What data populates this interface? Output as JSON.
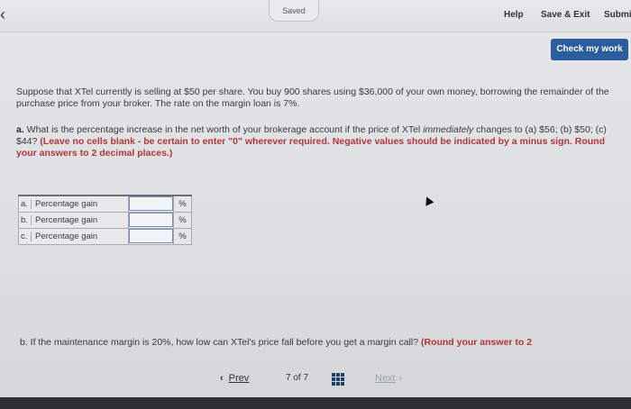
{
  "topbar": {
    "saved_label": "Saved",
    "help_label": "Help",
    "save_exit_label": "Save & Exit",
    "submit_label": "Submi"
  },
  "check_work_label": "Check my work",
  "question": {
    "text": "Suppose that XTel currently is selling at $50 per share. You buy 900 shares using $36,000 of your own money, borrowing the remainder of the purchase price from your broker. The rate on the margin loan is 7%."
  },
  "part_a": {
    "lead": "a.",
    "text_before_italic": " What is the percentage increase in the net worth of your brokerage account if the price of XTel ",
    "italic": "immediately",
    "text_after_italic": " changes to (a) $56; (b) $50; (c) $44? ",
    "instruction": "(Leave no cells blank - be certain to enter \"0\" wherever required. Negative values should be indicated by a minus sign. Round your answers to 2 decimal places.)"
  },
  "answer_rows": [
    {
      "letter": "a.",
      "label": "Percentage gain",
      "value": "",
      "unit": "%"
    },
    {
      "letter": "b.",
      "label": "Percentage gain",
      "value": "",
      "unit": "%"
    },
    {
      "letter": "c.",
      "label": "Percentage gain",
      "value": "",
      "unit": "%"
    }
  ],
  "part_b": {
    "text": "b. If the maintenance margin is 20%, how low can XTel's price fall before you get a margin call? ",
    "instruction": "(Round your answer to 2"
  },
  "nav": {
    "prev_label": "Prev",
    "page_indicator": "7 of 7",
    "next_label": "Next"
  },
  "colors": {
    "accent": "#2a5c9e",
    "instruction_red": "#b5343a"
  }
}
